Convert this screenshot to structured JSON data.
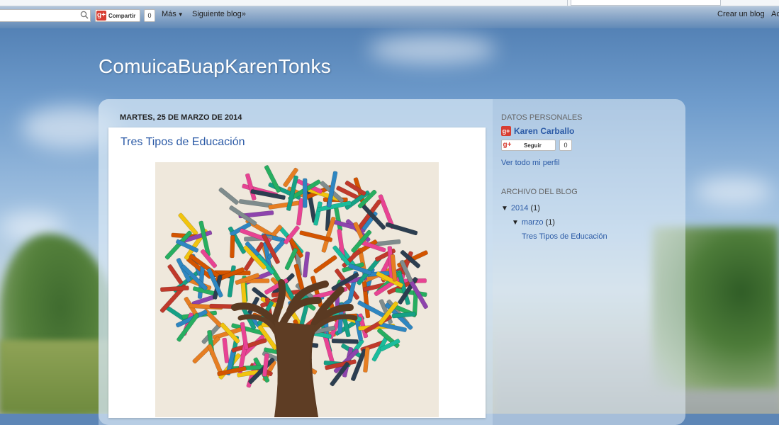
{
  "navbar": {
    "search_placeholder": "",
    "share_label": "Compartir",
    "share_count": "0",
    "more_label": "Más",
    "next_blog_label": "Siguiente blog»",
    "create_blog_label": "Crear un blog",
    "signin_partial": "Ac"
  },
  "blog": {
    "title": "ComuicaBuapKarenTonks"
  },
  "post": {
    "date_header": "MARTES, 25 DE MARZO DE 2014",
    "title": "Tres Tipos de Educación"
  },
  "sidebar": {
    "profile_header": "DATOS PERSONALES",
    "profile_name": "Karen Carballo",
    "follow_label": "Seguir",
    "follow_count": "0",
    "profile_link": "Ver todo mi perfil",
    "archive_header": "ARCHIVO DEL BLOG",
    "archive_year": "2014",
    "archive_year_count": "(1)",
    "archive_month": "marzo",
    "archive_month_count": "(1)",
    "archive_post": "Tres Tipos de Educación"
  },
  "colors": {
    "link": "#2b5aa6",
    "gplus": "#d73d32"
  }
}
